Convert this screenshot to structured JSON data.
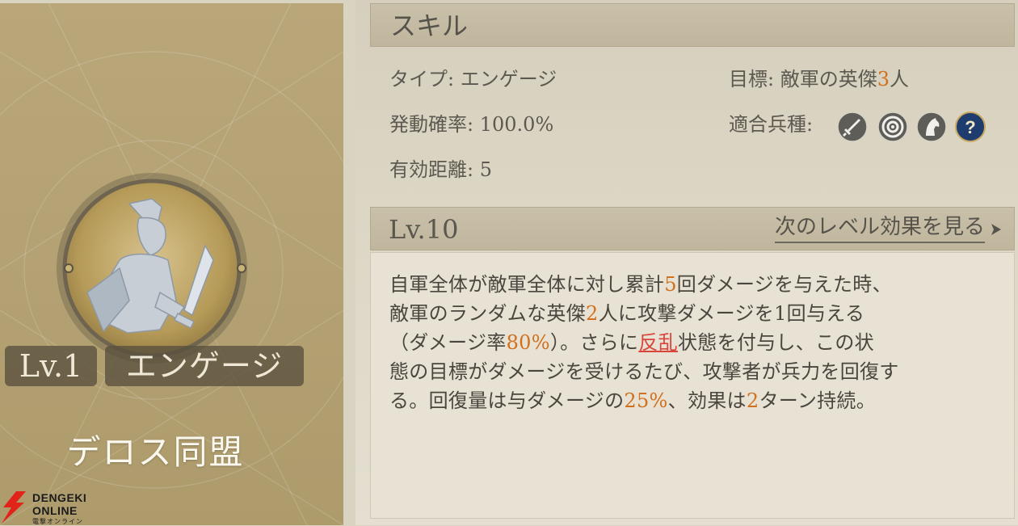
{
  "card": {
    "level_label": "Lv.1",
    "skill_name": "エンゲージ",
    "alliance_name": "デロス同盟"
  },
  "watermark": {
    "line1": "DENGEKI",
    "line2": "ONLINE",
    "line3": "電撃オンライン"
  },
  "skill": {
    "header": "スキル",
    "type_label": "タイプ:",
    "type_value": "エンゲージ",
    "rate_label": "発動確率:",
    "rate_value": "100.0%",
    "range_label": "有効距離:",
    "range_value": "5",
    "target_label": "目標:",
    "target_text": "敵軍の英傑",
    "target_count": "3",
    "target_unit": "人",
    "units_label": "適合兵種:",
    "unit_icons": [
      "sword-icon",
      "target-icon",
      "horse-icon",
      "question-icon"
    ]
  },
  "level": {
    "label": "Lv.10",
    "next_label": "次のレベル効果を見る"
  },
  "description": {
    "l1a": "自軍全体が敵軍全体に対し累計",
    "l1n": "5",
    "l1b": "回ダメージを与えた時、",
    "l2a": "敵軍のランダムな英傑",
    "l2n": "2",
    "l2b": "人に攻撃ダメージを1回与える",
    "l3a": "（ダメージ率",
    "l3n": "80%",
    "l3b": "）。さらに",
    "l3k": "反乱",
    "l3c": "状態を付与し、この状",
    "l4": "態の目標がダメージを受けるたび、攻撃者が兵力を回復す",
    "l5a": "る。回復量は与ダメージの",
    "l5n": "25%",
    "l5b": "、効果は",
    "l5m": "2",
    "l5c": "ターン持続。"
  },
  "colors": {
    "accent_orange": "#d2701e",
    "keyword_red": "#d9453a",
    "card_gold": "#b3a173",
    "icon_navy": "#1f3c6e"
  }
}
